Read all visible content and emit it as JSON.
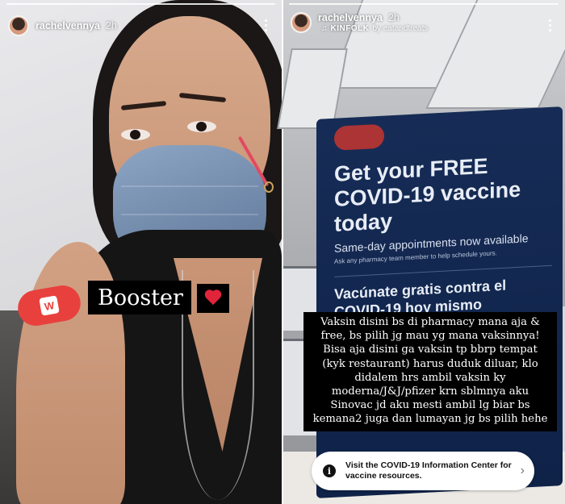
{
  "stories": [
    {
      "username": "rachelvennya",
      "timestamp": "2h",
      "sticker_text": "Booster",
      "sticker_emoji": "heart-emoji",
      "bandaid_badge": "W"
    },
    {
      "username": "rachelvennya",
      "timestamp": "2h",
      "music": {
        "icon": "music-note-icon",
        "title": "KINFOLK",
        "by": "by eatandtreats"
      },
      "sign": {
        "heading": "Get your FREE COVID-19 vaccine today",
        "subheading": "Same-day appointments now available",
        "fineprint": "Ask any pharmacy team member to help schedule yours.",
        "spanish": "Vacúnate gratis contra el COVID-19 hoy mismo"
      },
      "caption": "Vaksin disini bs di pharmacy mana aja & free, bs pilih jg mau yg mana vaksinnya! Bisa aja disini ga vaksin tp bbrp tempat (kyk restaurant) harus duduk diluar, klo didalem hrs ambil vaksin ky moderna/J&J/pfizer krn sblmnya aku Sinovac jd aku mesti ambil lg biar bs kemana2 juga dan lumayan jg bs pilih hehe",
      "info_banner": "Visit the COVID-19 Information Center for vaccine resources."
    }
  ],
  "colors": {
    "bandaid": "#e8413d",
    "heart": "#e0243a",
    "sign_navy": "#162c56"
  }
}
